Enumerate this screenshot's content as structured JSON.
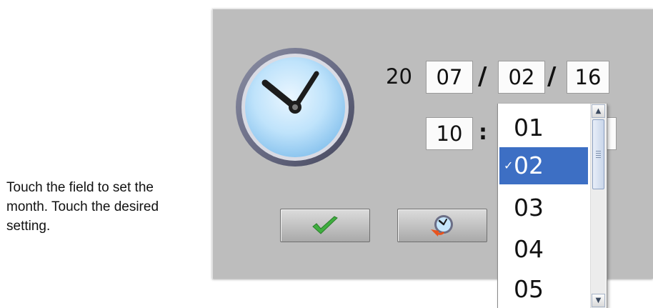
{
  "instruction": "Touch the field to set the month. Touch the desired setting.",
  "icons": {
    "clock": "clock-icon",
    "ok": "checkmark-icon",
    "reset": "clock-reset-icon",
    "scroll_up": "chevron-up-icon",
    "scroll_down": "chevron-down-icon"
  },
  "date": {
    "century": "20",
    "year": "07",
    "separator": "/",
    "month": "02",
    "day": "16"
  },
  "time": {
    "hour": "10",
    "separator": ":"
  },
  "month_dropdown": {
    "options": [
      "01",
      "02",
      "03",
      "04",
      "05"
    ],
    "selected": "02",
    "check_mark": "✓"
  },
  "colors": {
    "panel": "#bdbdbd",
    "selection": "#3d6fc4",
    "ok_icon": "#3fae3f"
  }
}
